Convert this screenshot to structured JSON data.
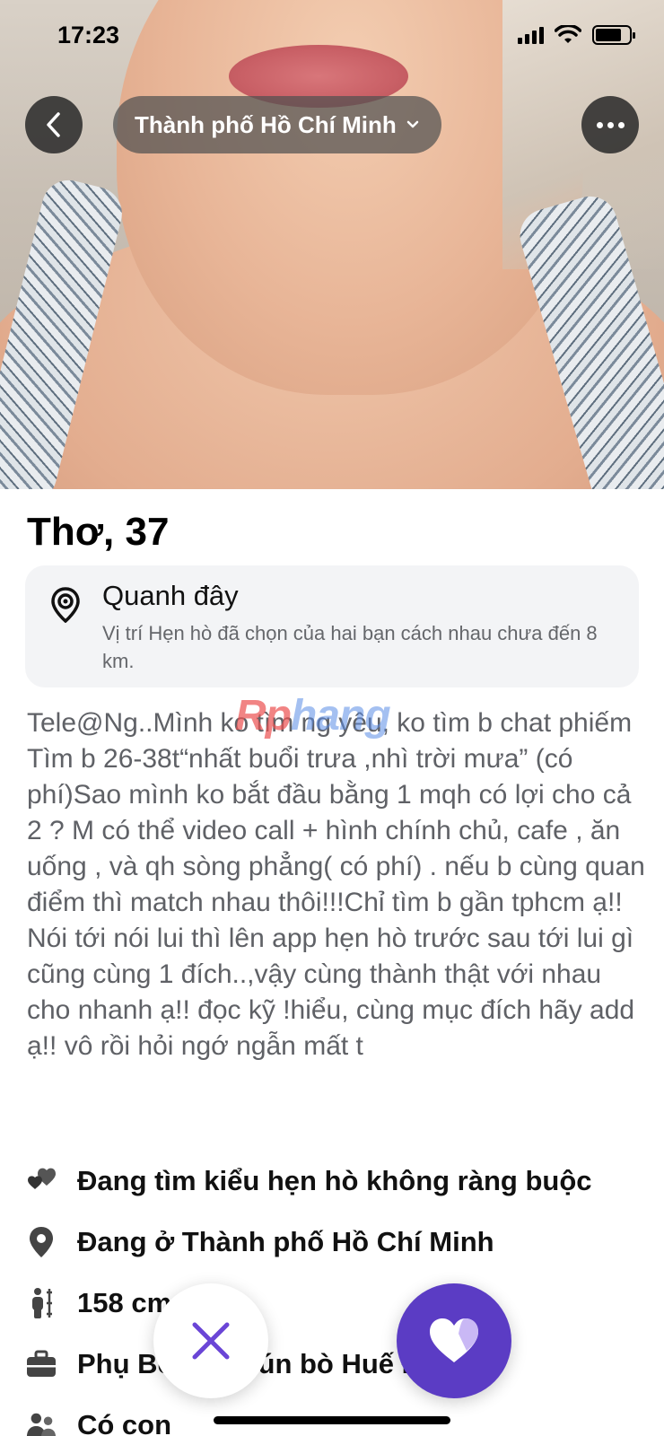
{
  "status_bar": {
    "time": "17:23"
  },
  "nav": {
    "city": "Thành phố Hồ Chí Minh"
  },
  "profile": {
    "name_age": "Thơ, 37",
    "nearby": {
      "title": "Quanh đây",
      "description": "Vị trí Hẹn hò đã chọn của hai bạn cách nhau chưa đến 8 km."
    },
    "watermark": {
      "part1": "Rp",
      "part2": "hang"
    },
    "bio": "Tele@Ng..Mình ko tìm ng yêu, ko tìm b chat phiếm Tìm  b 26-38t“nhất buổi trưa ,nhì trời mưa” (có phí)Sao mình ko bắt đầu bằng 1 mqh có lợi cho cả 2 ? M có thể video call + hình chính chủ, cafe , ăn uống , và qh sòng phẳng( có phí) . nếu b cùng quan điểm thì match nhau thôi!!!Chỉ tìm b gần tphcm ạ!! Nói tới nói lui thì lên app hẹn hò trước sau tới lui gì cũng cùng 1 đích..,vậy cùng thành thật với nhau cho nhanh ạ!! đọc kỹ !hiểu, cùng mục đích hãy add ạ!! vô rồi hỏi ngớ ngẫn mất t",
    "details": [
      {
        "icon": "hearts-icon",
        "text": "Đang tìm kiểu hẹn hò không ràng buộc"
      },
      {
        "icon": "location-pin-icon",
        "text": "Đang ở Thành phố Hồ Chí Minh"
      },
      {
        "icon": "height-icon",
        "text": "158 cm"
      },
      {
        "icon": "briefcase-icon",
        "text": "Phụ Bếp tại Bún bò Huế Đô"
      },
      {
        "icon": "people-icon",
        "text": "Có con"
      }
    ]
  },
  "colors": {
    "accent": "#5b3cc4",
    "card_bg": "#f3f4f6",
    "muted_text": "#65676b"
  }
}
